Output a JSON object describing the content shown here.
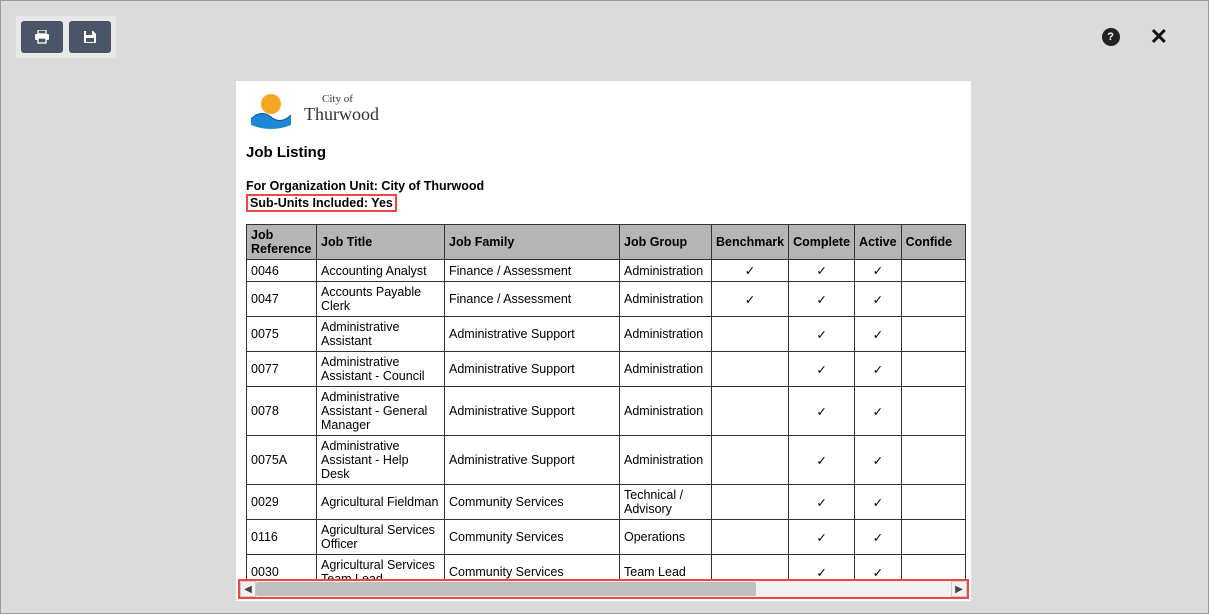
{
  "logo": {
    "small": "City of",
    "big": "Thurwood"
  },
  "report_title": "Job Listing",
  "org_line_prefix": "For Organization Unit: ",
  "org_line_value": "City of Thurwood",
  "subunits_line": "Sub-Units Included: Yes",
  "headers": {
    "ref": "Job Reference",
    "title": "Job Title",
    "family": "Job Family",
    "group": "Job Group",
    "bench": "Benchmark",
    "complete": "Complete",
    "active": "Active",
    "confid": "Confide"
  },
  "check": "✓",
  "rows": [
    {
      "ref": "0046",
      "title": "Accounting Analyst",
      "family": "Finance / Assessment",
      "group": "Administration",
      "bench": true,
      "complete": true,
      "active": true
    },
    {
      "ref": "0047",
      "title": "Accounts Payable Clerk",
      "family": "Finance / Assessment",
      "group": "Administration",
      "bench": true,
      "complete": true,
      "active": true
    },
    {
      "ref": "0075",
      "title": "Administrative Assistant",
      "family": "Administrative Support",
      "group": "Administration",
      "bench": false,
      "complete": true,
      "active": true
    },
    {
      "ref": "0077",
      "title": "Administrative Assistant - Council",
      "family": "Administrative Support",
      "group": "Administration",
      "bench": false,
      "complete": true,
      "active": true
    },
    {
      "ref": "0078",
      "title": "Administrative Assistant - General Manager",
      "family": "Administrative Support",
      "group": "Administration",
      "bench": false,
      "complete": true,
      "active": true
    },
    {
      "ref": "0075A",
      "title": "Administrative Assistant - Help Desk",
      "family": "Administrative Support",
      "group": "Administration",
      "bench": false,
      "complete": true,
      "active": true
    },
    {
      "ref": "0029",
      "title": "Agricultural Fieldman",
      "family": "Community Services",
      "group": "Technical / Advisory",
      "bench": false,
      "complete": true,
      "active": true
    },
    {
      "ref": "0116",
      "title": "Agricultural Services Officer",
      "family": "Community Services",
      "group": "Operations",
      "bench": false,
      "complete": true,
      "active": true
    },
    {
      "ref": "0030",
      "title": "Agricultural Services Team Lead",
      "family": "Community Services",
      "group": "Team Lead",
      "bench": false,
      "complete": true,
      "active": true
    }
  ]
}
